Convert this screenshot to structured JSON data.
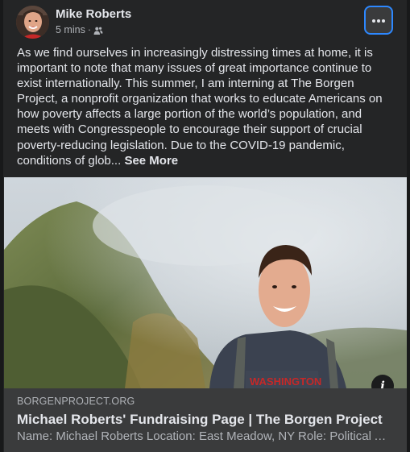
{
  "post": {
    "author": "Mike Roberts",
    "timestamp": "5 mins",
    "separator": "·",
    "audience_icon": "friends-icon",
    "more_icon": "ellipsis-icon",
    "text": "As we find ourselves in increasingly distressing times at home, it is important to note that many issues of great importance continue to exist internationally. This summer, I am interning at The Borgen Project, a nonprofit organization that works to educate Americans on how poverty affects a large portion of the world’s population, and meets with Congresspeople to encourage their support of crucial poverty-reducing legislation. Due to the COVID-19 pandemic, conditions of glob...",
    "see_more": "See More"
  },
  "link_preview": {
    "domain": "BORGENPROJECT.ORG",
    "title": "Michael Roberts' Fundraising Page | The Borgen Project",
    "description": "Name: Michael Roberts Location: East Meadow, NY Role: Political Affairs Intern",
    "info_icon": "info-icon",
    "info_glyph": "i"
  },
  "colors": {
    "background": "#242526",
    "text_primary": "#e4e6eb",
    "text_secondary": "#b0b3b8",
    "link_box": "#3a3b3c",
    "focus_ring": "#2d88ff"
  }
}
